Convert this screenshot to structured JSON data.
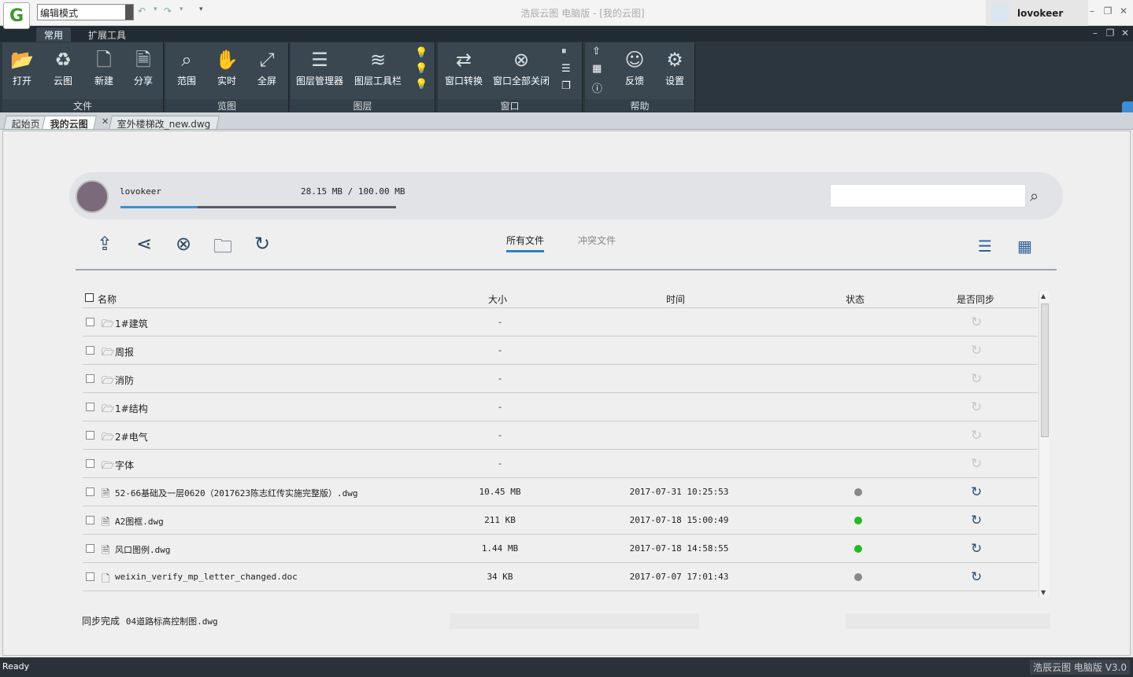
{
  "titlebar": {
    "logo": "G",
    "mode_value": "编辑模式",
    "app_title": "浩辰云图 电脑版 - [我的云图]",
    "username": "lovokeer",
    "minimize": "–",
    "restore": "❐",
    "close": "✕"
  },
  "ribbon": {
    "tabs": [
      "常用",
      "扩展工具"
    ],
    "groups": {
      "file": {
        "label": "文件",
        "buttons": [
          "打开",
          "云图",
          "新建",
          "分享"
        ]
      },
      "view": {
        "label": "览图",
        "buttons": [
          "范围",
          "实时",
          "全屏"
        ]
      },
      "layer": {
        "label": "图层",
        "buttons": [
          "图层管理器",
          "图层工具栏"
        ]
      },
      "window": {
        "label": "窗口",
        "buttons": [
          "窗口转换",
          "窗口全部关闭"
        ]
      },
      "help": {
        "label": "帮助",
        "buttons": [
          "反馈",
          "设置"
        ]
      }
    }
  },
  "doc_tabs": [
    "起始页",
    "我的云图",
    "室外楼梯改_new.dwg"
  ],
  "cloud": {
    "user": "lovokeer",
    "quota_text": "28.15 MB / 100.00 MB",
    "quota_fraction": 0.28,
    "search_placeholder": "",
    "file_tabs": [
      "所有文件",
      "冲突文件"
    ]
  },
  "table": {
    "headers": [
      "名称",
      "大小",
      "时间",
      "状态",
      "是否同步"
    ],
    "rows": [
      {
        "name": "1#建筑",
        "type": "folder",
        "size": "-",
        "time": "",
        "status": ""
      },
      {
        "name": "周报",
        "type": "folder",
        "size": "-",
        "time": "",
        "status": ""
      },
      {
        "name": "消防",
        "type": "folder",
        "size": "-",
        "time": "",
        "status": ""
      },
      {
        "name": "1#结构",
        "type": "folder",
        "size": "-",
        "time": "",
        "status": ""
      },
      {
        "name": "2#电气",
        "type": "folder",
        "size": "-",
        "time": "",
        "status": ""
      },
      {
        "name": "字体",
        "type": "folder",
        "size": "-",
        "time": "",
        "status": ""
      },
      {
        "name": "52-66基础及一层0620（2017623陈志红传实施完整版）.dwg",
        "type": "dwg",
        "size": "10.45 MB",
        "time": "2017-07-31 10:25:53",
        "status": "gray"
      },
      {
        "name": "A2图框.dwg",
        "type": "dwg",
        "size": "211 KB",
        "time": "2017-07-18 15:00:49",
        "status": "green"
      },
      {
        "name": "风口图例.dwg",
        "type": "dwg",
        "size": "1.44 MB",
        "time": "2017-07-18 14:58:55",
        "status": "green"
      },
      {
        "name": "weixin_verify_mp_letter_changed.doc",
        "type": "doc",
        "size": "34 KB",
        "time": "2017-07-07 17:01:43",
        "status": "gray"
      }
    ]
  },
  "footer": {
    "sync_status": "同步完成",
    "sync_file": "04道路标高控制图.dwg"
  },
  "statusbar": {
    "left": "Ready",
    "right": "浩辰云图 电脑版 V3.0"
  },
  "colors": {
    "accent": "#2f7fc8",
    "status_green": "#22bb22",
    "status_gray": "#888888",
    "ribbon_bg": "#2c363e"
  }
}
